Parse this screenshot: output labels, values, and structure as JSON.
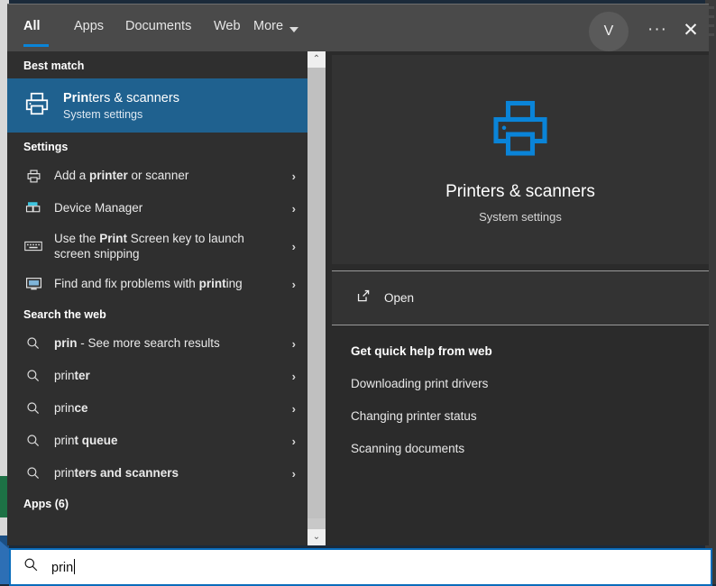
{
  "window": {
    "tabs": [
      {
        "label": "All",
        "active": true
      },
      {
        "label": "Apps",
        "active": false
      },
      {
        "label": "Documents",
        "active": false
      },
      {
        "label": "Web",
        "active": false
      },
      {
        "label": "More",
        "active": false
      }
    ],
    "avatar_initial": "V",
    "more_options_label": "···",
    "close_label": "✕"
  },
  "results": {
    "best_match_header": "Best match",
    "best_match": {
      "title_bold": "Prin",
      "title_rest": "ters & scanners",
      "subtitle": "System settings",
      "icon": "printer-icon"
    },
    "settings_header": "Settings",
    "settings_items": [
      {
        "pre": "Add a ",
        "bold": "printer",
        "post": " or scanner",
        "icon": "printer-icon",
        "chevron": "›"
      },
      {
        "pre": "Device Manager",
        "bold": "",
        "post": "",
        "icon": "device-manager-icon",
        "chevron": "›"
      },
      {
        "pre": "Use the ",
        "bold": "Print",
        "post": " Screen key to launch screen snipping",
        "icon": "keyboard-icon",
        "chevron": "›"
      },
      {
        "pre": "Find and fix problems with ",
        "bold": "print",
        "post": "ing",
        "icon": "troubleshoot-icon",
        "chevron": "›"
      }
    ],
    "web_header": "Search the web",
    "web_items": [
      {
        "pre": "",
        "bold": "prin",
        "post": " - See more search results",
        "icon": "search-icon",
        "chevron": "›"
      },
      {
        "pre": "prin",
        "bold": "ter",
        "post": "",
        "icon": "search-icon",
        "chevron": "›"
      },
      {
        "pre": "prin",
        "bold": "ce",
        "post": "",
        "icon": "search-icon",
        "chevron": "›"
      },
      {
        "pre": "prin",
        "bold": "t queue",
        "post": "",
        "icon": "search-icon",
        "chevron": "›"
      },
      {
        "pre": "prin",
        "bold": "ters and scanners",
        "post": "",
        "icon": "search-icon",
        "chevron": "›"
      }
    ],
    "apps_header": "Apps (6)"
  },
  "preview": {
    "icon": "printer-icon-large",
    "title": "Printers & scanners",
    "subtitle": "System settings",
    "open_label": "Open",
    "open_icon": "open-external-icon",
    "quick_help_header": "Get quick help from web",
    "quick_help_links": [
      "Downloading print drivers",
      "Changing printer status",
      "Scanning documents"
    ]
  },
  "search": {
    "value": "prin",
    "icon": "search-icon"
  },
  "scrollbar": {
    "up_arrow": "⌃",
    "down_arrow": "⌄"
  },
  "colors": {
    "accent_blue": "#0a84d8",
    "selection_blue": "#1f618f",
    "panel_bg": "#2b2b2b",
    "results_bg": "#2f2f2f",
    "tabbar_bg": "#4a4a4a",
    "icon_blue": "#0a84d8"
  }
}
